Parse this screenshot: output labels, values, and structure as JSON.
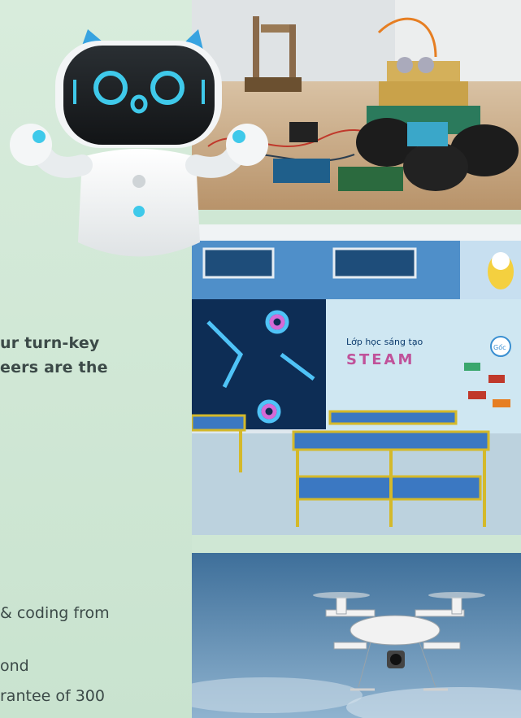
{
  "intro_fragments": {
    "line1": "ur turn-key",
    "line2": "eers are the"
  },
  "list_fragments": {
    "line1": "& coding from",
    "line2": "ond",
    "line3": "rantee of 300"
  },
  "classroom_sign": {
    "title": "Lớp học sáng tạo",
    "word": "STEAM",
    "badge": "Gốc"
  },
  "images": {
    "robot": "robot-illustration",
    "arduino": "arduino-robot-car-photo",
    "classroom": "steam-classroom-photo",
    "drone": "drone-photo"
  }
}
